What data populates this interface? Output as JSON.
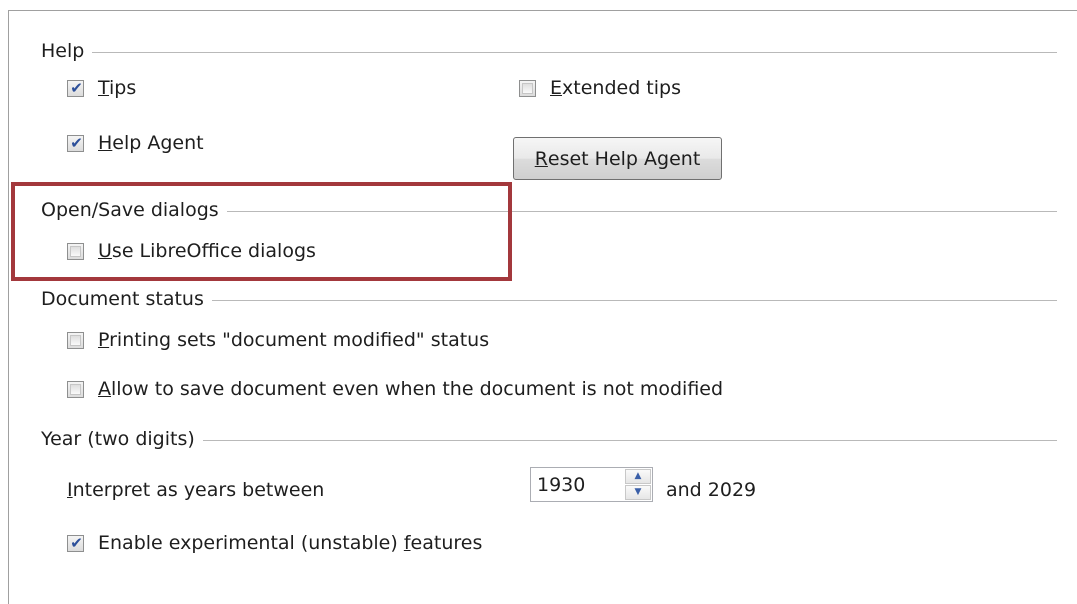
{
  "help": {
    "title": "Help",
    "tips": {
      "prefix": "",
      "mnemonic": "T",
      "rest": "ips",
      "checked": true
    },
    "extended_tips": {
      "prefix": "",
      "mnemonic": "E",
      "rest": "xtended tips",
      "checked": false
    },
    "help_agent": {
      "prefix": "",
      "mnemonic": "H",
      "rest": "elp Agent",
      "checked": true
    },
    "reset_button": {
      "mnemonic": "R",
      "rest": "eset Help Agent"
    }
  },
  "open_save": {
    "title": "Open/Save dialogs",
    "use_lo_dialogs": {
      "prefix": "",
      "mnemonic": "U",
      "rest": "se LibreOffice dialogs",
      "checked": false
    }
  },
  "document_status": {
    "title": "Document status",
    "printing_sets": {
      "prefix": "",
      "mnemonic": "P",
      "rest": "rinting sets \"document modified\" status",
      "checked": false
    },
    "allow_save": {
      "prefix": "",
      "mnemonic": "A",
      "rest": "llow to save document even when the document is not modified",
      "checked": false
    }
  },
  "year": {
    "title": "Year (two digits)",
    "interpret_label": {
      "mnemonic": "I",
      "rest": "nterpret as years between"
    },
    "start_year": "1930",
    "and_label": "and 2029"
  },
  "experimental": {
    "prefix": "Enable experimental (unstable) ",
    "mnemonic": "f",
    "rest": "eatures",
    "checked": true
  },
  "highlight_color": "#a3383c",
  "check_mark": "✔"
}
